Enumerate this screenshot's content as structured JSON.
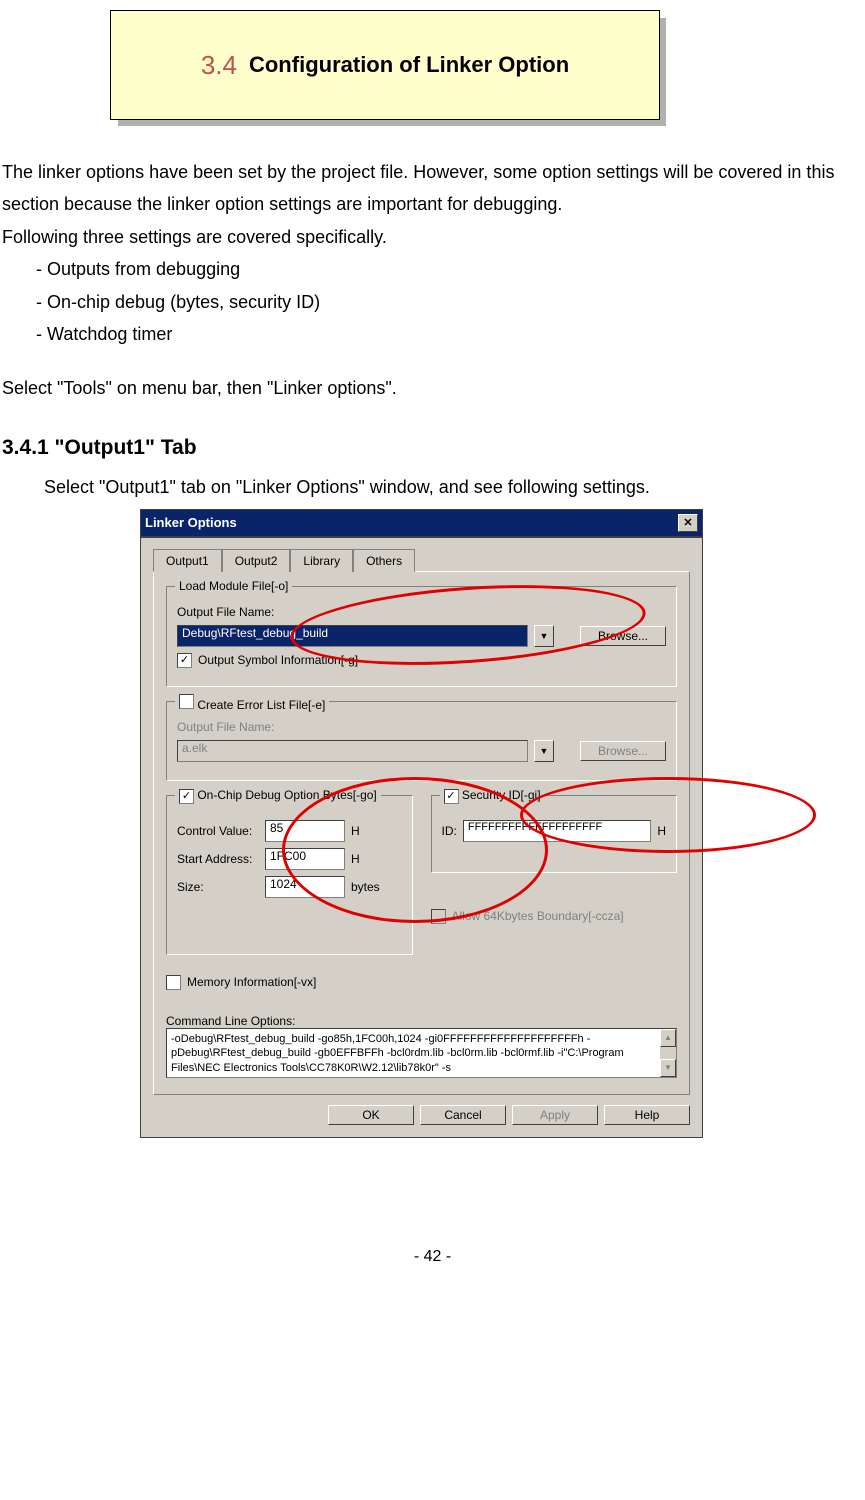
{
  "banner": {
    "number": "3.4",
    "title": "Configuration of Linker Option"
  },
  "para1": "The linker options have been set by the project file. However, some option settings will be covered in this section because the linker option settings are important for debugging.",
  "para2": "Following three settings are covered specifically.",
  "bullets": {
    "b1": "- Outputs from debugging",
    "b2": "- On-chip debug (bytes, security ID)",
    "b3": "- Watchdog timer"
  },
  "para3": "Select \"Tools\" on menu bar, then \"Linker options\".",
  "subsection": {
    "heading": "3.4.1 \"Output1\" Tab",
    "lead": "Select \"Output1\" tab on \"Linker Options\" window, and see following settings."
  },
  "dialog": {
    "title": "Linker Options",
    "tabs": {
      "t1": "Output1",
      "t2": "Output2",
      "t3": "Library",
      "t4": "Others"
    },
    "group1": {
      "legend": "Load Module File[-o]",
      "out_label": "Output File Name:",
      "out_value": "Debug\\RFtest_debug_build",
      "browse": "Browse...",
      "chk_sym": "Output Symbol Information[-g]"
    },
    "group2": {
      "chk_legend": "Create Error List File[-e]",
      "out_label": "Output File Name:",
      "out_value": "a.elk",
      "browse": "Browse..."
    },
    "group3": {
      "chk_legend": "On-Chip Debug Option Bytes[-go]",
      "cv_label": "Control Value:",
      "cv_value": "85",
      "cv_unit": "H",
      "sa_label": "Start Address:",
      "sa_value": "1FC00",
      "sa_unit": "H",
      "sz_label": "Size:",
      "sz_value": "1024",
      "sz_unit": "bytes"
    },
    "group4": {
      "chk_legend": "Security ID[-gi]",
      "id_label": "ID:",
      "id_value": "FFFFFFFFFFFFFFFFFFFF",
      "id_unit": "H"
    },
    "chk_boundary": "Allow 64Kbytes Boundary[-ccza]",
    "chk_meminfo": "Memory Information[-vx]",
    "cmd_label": "Command Line Options:",
    "cmd_value": "-oDebug\\RFtest_debug_build -go85h,1FC00h,1024 -gi0FFFFFFFFFFFFFFFFFFFFh -pDebug\\RFtest_debug_build -gb0EFFBFFh -bcl0rdm.lib -bcl0rm.lib -bcl0rmf.lib -i\"C:\\Program Files\\NEC Electronics Tools\\CC78K0R\\W2.12\\lib78k0r\" -s",
    "buttons": {
      "ok": "OK",
      "cancel": "Cancel",
      "apply": "Apply",
      "help": "Help"
    }
  },
  "pagenum": "- 42 -"
}
